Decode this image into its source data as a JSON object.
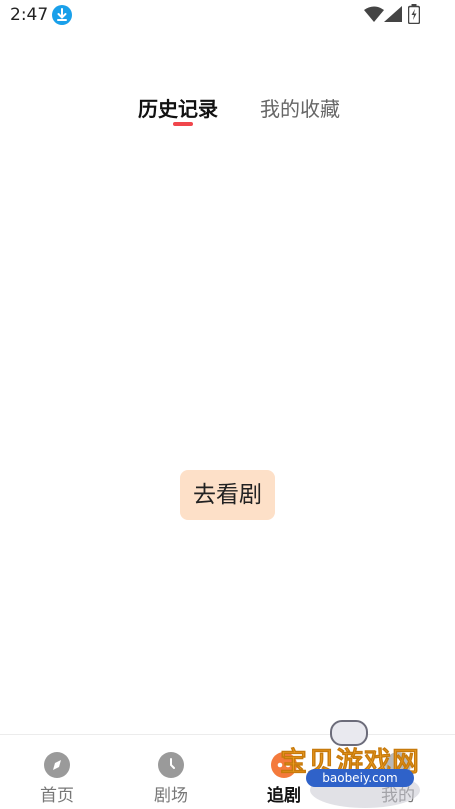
{
  "status_bar": {
    "time": "2:47",
    "icons": [
      "download-icon",
      "wifi-icon",
      "signal-icon",
      "battery-icon"
    ]
  },
  "top_tabs": {
    "history": "历史记录",
    "favorites": "我的收藏",
    "active": "history"
  },
  "empty_state": {
    "button_label": "去看剧"
  },
  "bottom_nav": {
    "items": [
      {
        "label": "首页",
        "icon": "compass-icon"
      },
      {
        "label": "剧场",
        "icon": "clock-icon"
      },
      {
        "label": "追剧",
        "icon": "follow-icon"
      },
      {
        "label": "我的",
        "icon": "profile-icon"
      }
    ],
    "active_index": 2
  },
  "watermark": {
    "title": "宝贝游戏网",
    "url": "baobeiy.com"
  },
  "colors": {
    "accent": "#f0464c",
    "button_bg": "#fde0c8",
    "active_tab_icon": "#f47a3c",
    "status_badge": "#1aa0ea"
  }
}
